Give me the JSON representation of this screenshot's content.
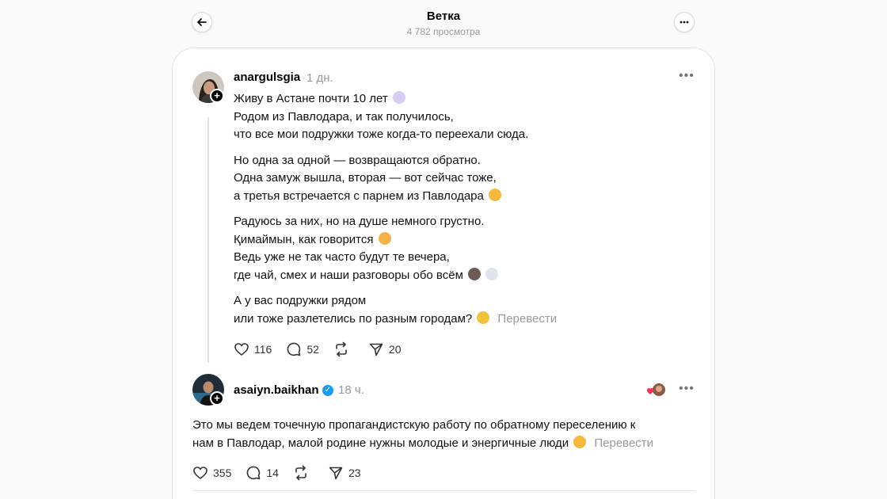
{
  "header": {
    "title": "Ветка",
    "views": "4 782 просмотра",
    "back_icon": "arrow-left-icon",
    "more_icon": "more-horizontal-icon"
  },
  "post": {
    "username": "anargulsgia",
    "time": "1 дн.",
    "paragraphs": [
      [
        "Живу в Астане почти 10 лет",
        "Родом из Павлодара, и так получилось,",
        "что все мои подружки тоже когда-то переехали сюда."
      ],
      [
        "Но одна за одной — возвращаются обратно.",
        "Одна замуж вышла, вторая — вот сейчас тоже,",
        "а третья встречается с парнем из Павлодара"
      ],
      [
        "Радуюсь за них, но на душе немного грустно.",
        "Қимаймын, как говорится",
        "Ведь уже не так часто будут те вечера,",
        "где чай, смех и наши разговоры обо всём"
      ],
      [
        "А у вас подружки рядом",
        "или тоже разлетелись по разным городам?"
      ]
    ],
    "translate": "Перевести",
    "likes": "116",
    "comments": "52",
    "reposts": "",
    "shares": "20"
  },
  "reply": {
    "username": "asaiyn.baikhan",
    "time": "18 ч.",
    "verified": true,
    "text_line1": "Это мы ведем точечную пропагандистскую работу по обратному переселению к",
    "text_line2": "нам в Павлодар, малой родине нужны молодые и энергичные люди",
    "translate": "Перевести",
    "likes": "355",
    "comments": "14",
    "shares": "23"
  },
  "colors": {
    "background": "#fafafa",
    "card": "#ffffff",
    "muted": "#999999",
    "verified": "#1d9bf0"
  }
}
